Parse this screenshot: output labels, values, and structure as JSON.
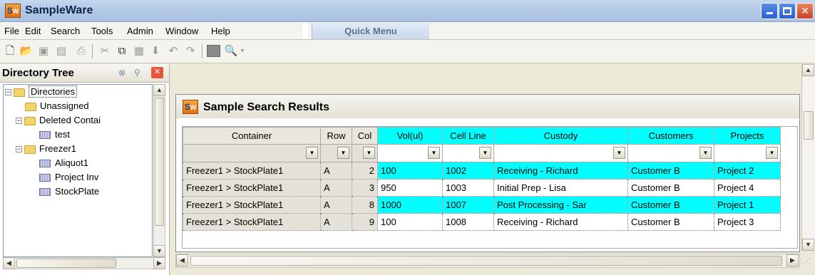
{
  "window": {
    "title": "SampleWare",
    "logo_text": "S",
    "logo_sub": "W",
    "min_icon": "minimize-icon",
    "max_icon": "maximize-icon",
    "close_icon": "close-icon"
  },
  "menu": {
    "items": [
      "File",
      "Edit",
      "Search",
      "Tools",
      "Admin",
      "Window",
      "Help"
    ],
    "quick_menu": "Quick Menu"
  },
  "toolbar": {
    "icons": [
      "new-icon",
      "open-icon",
      "save-icon",
      "save-all-icon",
      "print-icon",
      "cut-icon",
      "copy-icon",
      "paste-icon",
      "down-arrow-icon",
      "undo-icon",
      "redo-icon",
      "block-icon",
      "find-icon"
    ]
  },
  "left_panel": {
    "title": "Directory Tree",
    "tree": [
      {
        "label": "Directories",
        "type": "folder",
        "expander": "−",
        "level": 0
      },
      {
        "label": "Unassigned",
        "type": "folder",
        "expander": "",
        "level": 1
      },
      {
        "label": "Deleted Contai",
        "type": "folder",
        "expander": "−",
        "level": 1
      },
      {
        "label": "test",
        "type": "plate",
        "expander": "",
        "level": 2
      },
      {
        "label": "Freezer1",
        "type": "folder",
        "expander": "−",
        "level": 1
      },
      {
        "label": "Aliquot1",
        "type": "plate",
        "expander": "",
        "level": 2
      },
      {
        "label": "Project Inv",
        "type": "plate",
        "expander": "",
        "level": 2
      },
      {
        "label": "StockPlate",
        "type": "plate",
        "expander": "",
        "level": 2
      }
    ]
  },
  "results": {
    "title": "Sample Search Results",
    "columns": [
      "Container",
      "Row",
      "Col",
      "Vol(ul)",
      "Cell Line",
      "Custody",
      "Customers",
      "Projects"
    ],
    "rows": [
      {
        "container": "Freezer1 > StockPlate1",
        "row": "A",
        "col": "2",
        "vol": "100",
        "cell_line": "1002",
        "custody": "Receiving - Richard",
        "customer": "Customer B",
        "project": "Project 2",
        "highlight": true
      },
      {
        "container": "Freezer1 > StockPlate1",
        "row": "A",
        "col": "3",
        "vol": "950",
        "cell_line": "1003",
        "custody": "Initial Prep - Lisa",
        "customer": "Customer B",
        "project": "Project 4",
        "highlight": false
      },
      {
        "container": "Freezer1 > StockPlate1",
        "row": "A",
        "col": "8",
        "vol": "1000",
        "cell_line": "1007",
        "custody": "Post Processing - Sar",
        "customer": "Customer B",
        "project": "Project 1",
        "highlight": true
      },
      {
        "container": "Freezer1 > StockPlate1",
        "row": "A",
        "col": "9",
        "vol": "100",
        "cell_line": "1008",
        "custody": "Receiving - Richard",
        "customer": "Customer B",
        "project": "Project 3",
        "highlight": false
      }
    ]
  },
  "colors": {
    "highlight": "#00ffff",
    "title_bar": "#b3c8e6",
    "quick_menu_text": "#5a7290"
  }
}
